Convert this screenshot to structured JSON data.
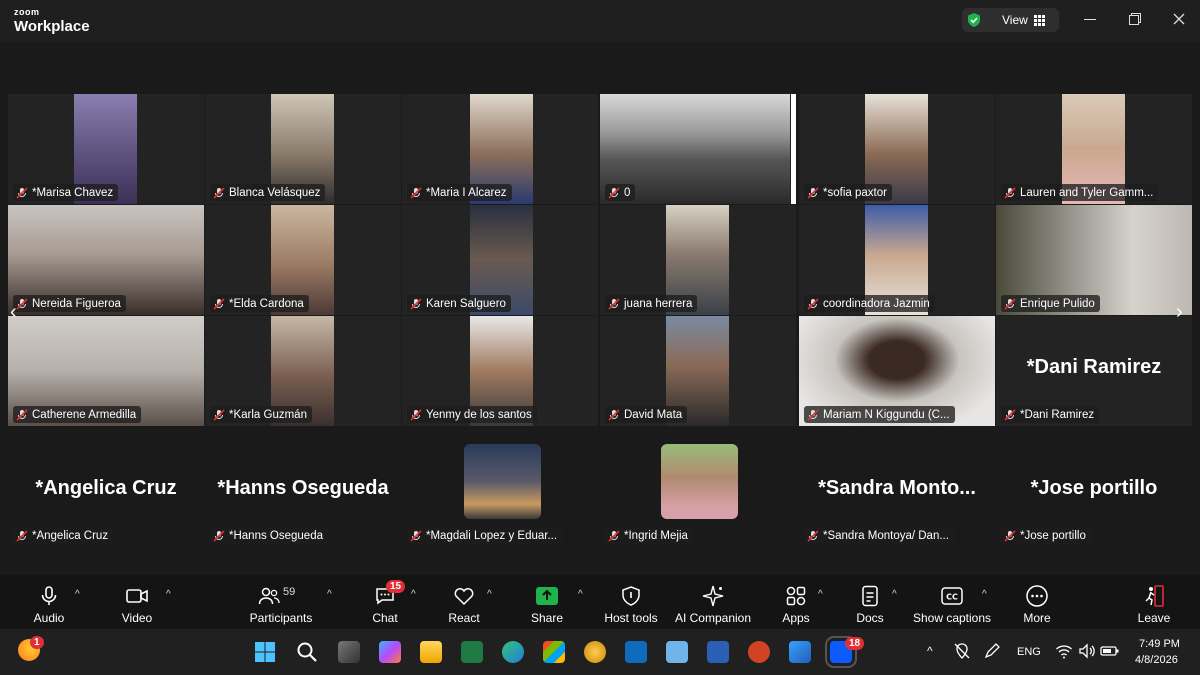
{
  "app": {
    "brand_top": "zoom",
    "brand_bottom": "Workplace",
    "view_label": "View"
  },
  "tiles": [
    {
      "label": "*Marisa Chavez",
      "big": ""
    },
    {
      "label": "Blanca Velásquez",
      "big": ""
    },
    {
      "label": "*Maria I Alcarez",
      "big": ""
    },
    {
      "label": "0",
      "big": ""
    },
    {
      "label": "*sofia paxtor",
      "big": ""
    },
    {
      "label": "Lauren and Tyler Gamm...",
      "big": ""
    },
    {
      "label": "Nereida Figueroa",
      "big": ""
    },
    {
      "label": "*Elda Cardona",
      "big": ""
    },
    {
      "label": "Karen Salguero",
      "big": ""
    },
    {
      "label": "juana herrera",
      "big": ""
    },
    {
      "label": "coordinadora Jazmin",
      "big": ""
    },
    {
      "label": "Enrique Pulido",
      "big": ""
    },
    {
      "label": "Catherene Armedilla",
      "big": ""
    },
    {
      "label": "*Karla Guzmán",
      "big": ""
    },
    {
      "label": "Yenmy de los santos",
      "big": ""
    },
    {
      "label": "David Mata",
      "big": ""
    },
    {
      "label": "Mariam N Kiggundu (C...",
      "big": ""
    },
    {
      "label": "*Dani Ramirez",
      "big": "*Dani Ramirez"
    },
    {
      "label": "*Angelica Cruz",
      "big": "*Angelica Cruz"
    },
    {
      "label": "*Hanns Osegueda",
      "big": "*Hanns Osegueda"
    },
    {
      "label": "*Magdali Lopez y Eduar...",
      "big": ""
    },
    {
      "label": "*Ingrid Mejia",
      "big": ""
    },
    {
      "label": "*Sandra Montoya/ Dan...",
      "big": "*Sandra  Monto..."
    },
    {
      "label": "*Jose portillo",
      "big": "*Jose portillo"
    }
  ],
  "toolbar": {
    "audio": "Audio",
    "video": "Video",
    "participants": "Participants",
    "participants_count": "59",
    "chat": "Chat",
    "chat_badge": "15",
    "react": "React",
    "share": "Share",
    "host_tools": "Host tools",
    "ai_companion": "AI Companion",
    "apps": "Apps",
    "docs": "Docs",
    "captions": "Show captions",
    "more": "More",
    "leave": "Leave"
  },
  "taskbar": {
    "weather_badge": "1",
    "zoom_badge": "18",
    "language": "ENG",
    "time": "7:49 PM",
    "date": "4/8/2026"
  },
  "colors": {
    "accent_green": "#20b24b",
    "mic_red": "#e02f36",
    "badge_red": "#e02f36"
  }
}
